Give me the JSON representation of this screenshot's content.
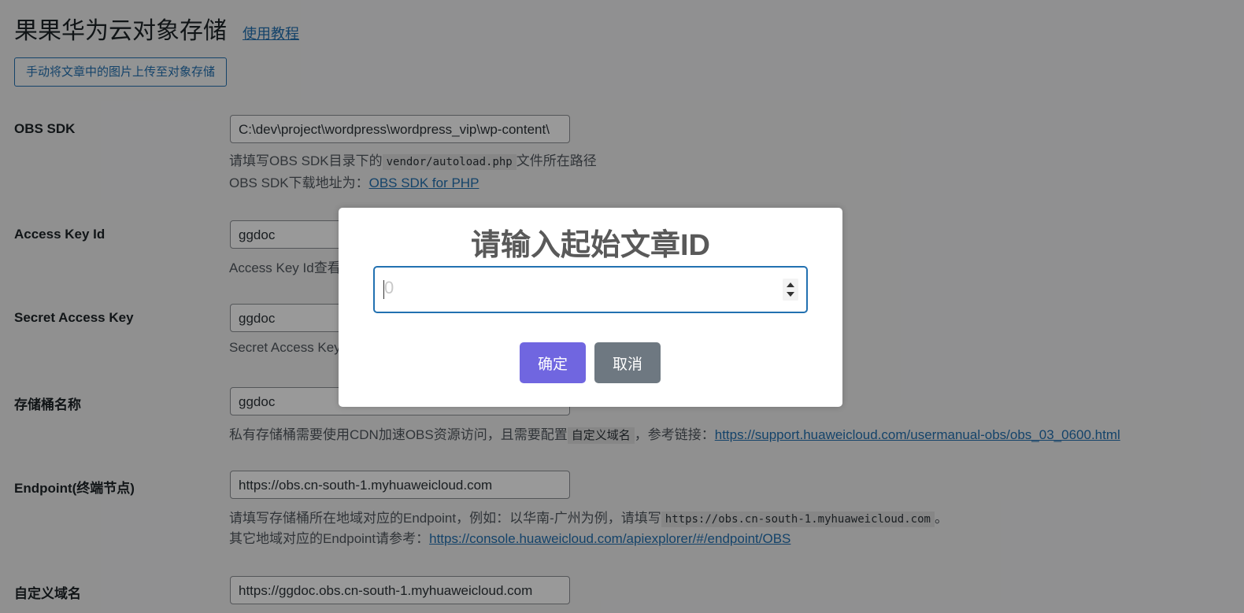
{
  "header": {
    "title": "果果华为云对象存储",
    "tutorial_link": "使用教程",
    "upload_button": "手动将文章中的图片上传至对象存储"
  },
  "fields": {
    "obs_sdk": {
      "label": "OBS SDK",
      "value": "C:\\dev\\project\\wordpress\\wordpress_vip\\wp-content\\",
      "desc1_pre": "请填写OBS SDK目录下的",
      "desc1_code": "vendor/autoload.php",
      "desc1_post": "文件所在路径",
      "desc2_pre": "OBS SDK下载地址为：",
      "desc2_link": "OBS SDK for PHP"
    },
    "access_key": {
      "label": "Access Key Id",
      "value": "ggdoc",
      "desc": "Access Key Id查看"
    },
    "secret_key": {
      "label": "Secret Access Key",
      "value": "ggdoc",
      "desc": "Secret Access Key"
    },
    "bucket": {
      "label": "存储桶名称",
      "value": "ggdoc",
      "desc_pre": "私有存储桶需要使用CDN加速OBS资源访问，且需要配置",
      "desc_code": "自定义域名",
      "desc_mid": "，参考链接：",
      "desc_link": "https://support.huaweicloud.com/usermanual-obs/obs_03_0600.html"
    },
    "endpoint": {
      "label": "Endpoint(终端节点)",
      "value": "https://obs.cn-south-1.myhuaweicloud.com",
      "desc1_pre": "请填写存储桶所在地域对应的Endpoint，例如：以华南-广州为例，请填写",
      "desc1_code": "https://obs.cn-south-1.myhuaweicloud.com",
      "desc1_post": "。",
      "desc2_pre": "其它地域对应的Endpoint请参考：",
      "desc2_link": "https://console.huaweicloud.com/apiexplorer/#/endpoint/OBS"
    },
    "custom_domain": {
      "label": "自定义域名",
      "value": "https://ggdoc.obs.cn-south-1.myhuaweicloud.com"
    }
  },
  "modal": {
    "title": "请输入起始文章ID",
    "input_placeholder": "0",
    "ok_label": "确定",
    "cancel_label": "取消"
  },
  "colors": {
    "overlay": "rgba(0,0,0,0.4)",
    "link": "#2271b1",
    "ok_button": "#7066e0",
    "cancel_button": "#6e7881"
  }
}
